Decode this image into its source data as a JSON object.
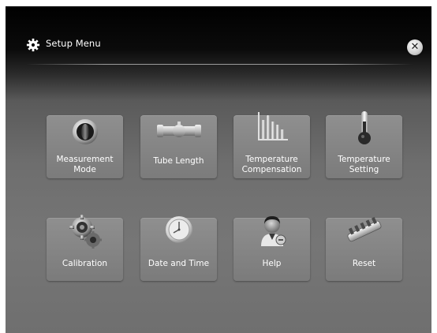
{
  "header": {
    "title": "Setup Menu",
    "title_icon": "gear-icon",
    "close_icon": "close-icon",
    "close_glyph": "✕"
  },
  "menu": [
    {
      "label_lines": [
        "Measurement",
        "Mode"
      ],
      "icon": "measurement-mode-icon"
    },
    {
      "label_lines": [
        "Tube Length"
      ],
      "icon": "tube-icon"
    },
    {
      "label_lines": [
        "Temperature",
        "Compensation"
      ],
      "icon": "bar-chart-icon"
    },
    {
      "label_lines": [
        "Temperature",
        "Setting"
      ],
      "icon": "thermometer-icon"
    },
    {
      "label_lines": [
        "Calibration"
      ],
      "icon": "gears-icon"
    },
    {
      "label_lines": [
        "Date and Time"
      ],
      "icon": "clock-icon"
    },
    {
      "label_lines": [
        "Help"
      ],
      "icon": "help-person-icon"
    },
    {
      "label_lines": [
        "Reset"
      ],
      "icon": "reset-icon"
    }
  ],
  "colors": {
    "tile": "#8a8a8a",
    "background_top": "#000000",
    "background_main": "#767676",
    "text": "#ffffff"
  }
}
